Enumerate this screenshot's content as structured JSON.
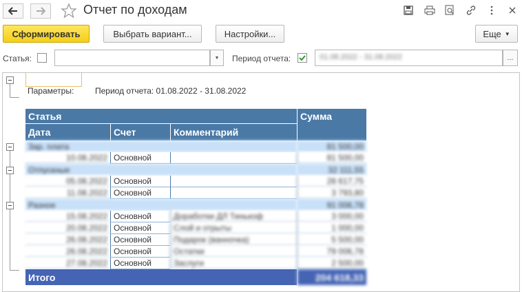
{
  "window": {
    "title": "Отчет по доходам"
  },
  "toolbar": {
    "generate": "Сформировать",
    "choose_variant": "Выбрать вариант...",
    "settings": "Настройки...",
    "more": "Еще"
  },
  "filters": {
    "article_label": "Статья:",
    "article_value": "",
    "period_label": "Период отчета:",
    "period_value": "01.08.2022 - 31.08.2022",
    "period_btn": "..."
  },
  "report": {
    "params_label": "Параметры:",
    "params_value": "Период отчета: 01.08.2022 - 31.08.2022",
    "headers": {
      "article": "Статья",
      "sum": "Сумма",
      "date": "Дата",
      "account": "Счет",
      "comment": "Комментарий"
    },
    "groups": [
      {
        "name": "Зар. плата",
        "sum": "81 500,00",
        "rows": [
          {
            "date": "10.08.2022",
            "account": "Основной",
            "comment": "",
            "sum": "81 500,00"
          }
        ]
      },
      {
        "name": "Отпускные",
        "sum": "32 111,55",
        "rows": [
          {
            "date": "05.08.2022",
            "account": "Основной",
            "comment": "",
            "sum": "28 617,75"
          },
          {
            "date": "11.08.2022",
            "account": "Основной",
            "comment": "",
            "sum": "3 793,80"
          }
        ]
      },
      {
        "name": "Разное",
        "sum": "91 006,78",
        "rows": [
          {
            "date": "15.08.2022",
            "account": "Основной",
            "comment": "Доработки ДЛ Тинькоф",
            "sum": "3 000,00"
          },
          {
            "date": "20.08.2022",
            "account": "Основной",
            "comment": "Слой и отрыты",
            "sum": "1 000,00"
          },
          {
            "date": "26.08.2022",
            "account": "Основной",
            "comment": "Подарок (ванночка)",
            "sum": "5 500,00"
          },
          {
            "date": "26.08.2022",
            "account": "Основной",
            "comment": "Остатки",
            "sum": "79 006,78"
          },
          {
            "date": "27.08.2022",
            "account": "Основной",
            "comment": "Заслуги",
            "sum": "2 500,00"
          }
        ]
      }
    ],
    "total_label": "Итого",
    "total_sum": "204 618,33"
  }
}
